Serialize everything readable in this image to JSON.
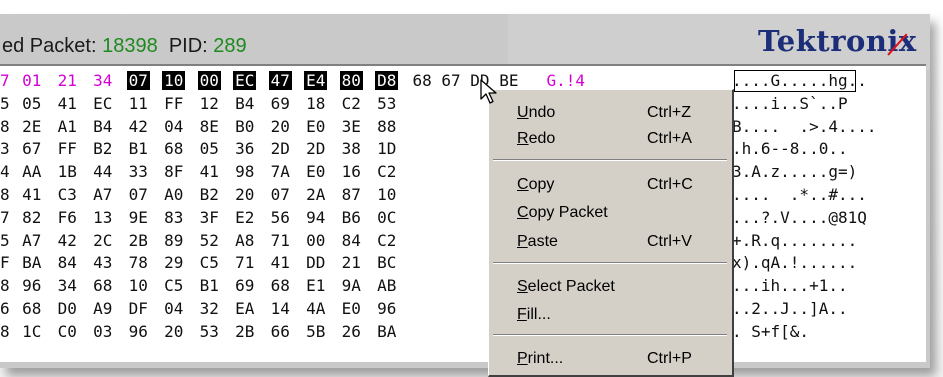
{
  "header": {
    "label_prefix": "ed Packet:",
    "packet_value": "18398",
    "pid_label": "PID:",
    "pid_value": "289"
  },
  "logo": {
    "text": "Tektronix"
  },
  "hex_rows": [
    {
      "lead": "7",
      "bytes": [
        "01",
        "21",
        "34",
        "07",
        "10",
        "00",
        "EC",
        "47",
        "E4",
        "80",
        "D8"
      ],
      "extra": "68 67 DD BE",
      "extra2": "G.!4",
      "ascii": "....G.....hg.."
    },
    {
      "lead": "5",
      "bytes": [
        "05",
        "41",
        "EC",
        "11",
        "FF",
        "12",
        "B4",
        "69",
        "18",
        "C2",
        "53"
      ],
      "ascii": "....i..S`..P"
    },
    {
      "lead": "8",
      "bytes": [
        "2E",
        "A1",
        "B4",
        "42",
        "04",
        "8E",
        "B0",
        "20",
        "E0",
        "3E",
        "88"
      ],
      "ascii": "B....  .>.4...."
    },
    {
      "lead": "3",
      "bytes": [
        "67",
        "FF",
        "B2",
        "B1",
        "68",
        "05",
        "36",
        "2D",
        "2D",
        "38",
        "1D"
      ],
      "ascii": ".h.6--8..0.."
    },
    {
      "lead": "4",
      "bytes": [
        "AA",
        "1B",
        "44",
        "33",
        "8F",
        "41",
        "98",
        "7A",
        "E0",
        "16",
        "C2"
      ],
      "ascii": "3.A.z.....g=)"
    },
    {
      "lead": "8",
      "bytes": [
        "41",
        "C3",
        "A7",
        "07",
        "A0",
        "B2",
        "20",
        "07",
        "2A",
        "87",
        "10"
      ],
      "ascii": "....  .*..#..."
    },
    {
      "lead": "7",
      "bytes": [
        "82",
        "F6",
        "13",
        "9E",
        "83",
        "3F",
        "E2",
        "56",
        "94",
        "B6",
        "0C"
      ],
      "ascii": "...?.V....@81Q"
    },
    {
      "lead": "5",
      "bytes": [
        "A7",
        "42",
        "2C",
        "2B",
        "89",
        "52",
        "A8",
        "71",
        "00",
        "84",
        "C2"
      ],
      "ascii": "+.R.q........"
    },
    {
      "lead": "F",
      "bytes": [
        "BA",
        "84",
        "43",
        "78",
        "29",
        "C5",
        "71",
        "41",
        "DD",
        "21",
        "BC"
      ],
      "ascii": "x).qA.!......"
    },
    {
      "lead": "8",
      "bytes": [
        "96",
        "34",
        "68",
        "10",
        "C5",
        "B1",
        "69",
        "68",
        "E1",
        "9A",
        "AB"
      ],
      "ascii": "...ih...+1.."
    },
    {
      "lead": "6",
      "bytes": [
        "68",
        "D0",
        "A9",
        "DF",
        "04",
        "32",
        "EA",
        "14",
        "4A",
        "E0",
        "96"
      ],
      "ascii": "..2..J..]A.."
    },
    {
      "lead": "8",
      "bytes": [
        "1C",
        "C0",
        "03",
        "96",
        "20",
        "53",
        "2B",
        "66",
        "5B",
        "26",
        "BA"
      ],
      "ascii": ". S+f[&."
    }
  ],
  "menu": {
    "items": [
      {
        "label": "Undo",
        "shortcut": "Ctrl+Z"
      },
      {
        "label": "Redo",
        "shortcut": "Ctrl+A"
      },
      {
        "label": "Copy",
        "shortcut": "Ctrl+C"
      },
      {
        "label": "Copy Packet",
        "shortcut": ""
      },
      {
        "label": "Paste",
        "shortcut": "Ctrl+V"
      },
      {
        "label": "Select Packet",
        "shortcut": ""
      },
      {
        "label": "Fill...",
        "shortcut": ""
      },
      {
        "label": "Print...",
        "shortcut": "Ctrl+P"
      }
    ]
  },
  "colors": {
    "green_value": "#1e8a1e",
    "logo_blue": "#1c2e79",
    "logo_slash": "#e0101a",
    "magenta": "#d400d4",
    "menu_bg": "#d4d0c8"
  },
  "icons": {
    "cursor": "arrow-cursor-icon"
  }
}
